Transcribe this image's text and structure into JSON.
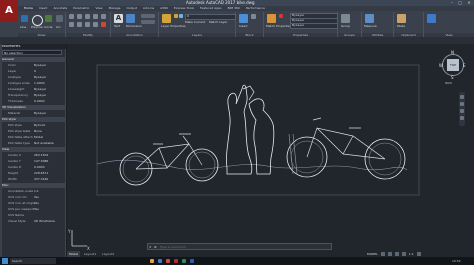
{
  "window": {
    "title": "Autodesk AutoCAD 2017   bike.dwg"
  },
  "app": {
    "logo": "A",
    "accent": "#8f1b1b"
  },
  "ribbon_tabs": [
    "Home",
    "Insert",
    "Annotate",
    "Parametric",
    "View",
    "Manage",
    "Output",
    "Add-ins",
    "A360",
    "Express Tools",
    "Featured Apps",
    "BIM 360",
    "Performance"
  ],
  "ribbon": {
    "panels": [
      "Draw",
      "Modify",
      "Annotation",
      "Layers",
      "Block",
      "Properties",
      "Groups",
      "Utilities",
      "Clipboard",
      "View"
    ],
    "draw_tools": [
      "Line",
      "Polyline",
      "Circle",
      "Arc"
    ],
    "text_tool": "Text",
    "dimension_tool": "Dimension",
    "insert_tool": "Insert",
    "match_properties_tool": "Match Properties",
    "layer_properties_tool": "Layer Properties",
    "layer_combo": "0",
    "bylayer_1": "ByLayer",
    "bylayer_2": "ByLayer",
    "bylayer_3": "ByLayer",
    "make_current": "Make Current",
    "match_layer": "Match Layer",
    "measure_tool": "Measure",
    "paste_tool": "Paste",
    "group_tool": "Group"
  },
  "properties": {
    "header": "PROPERTIES",
    "object_type": "No selection",
    "sections": [
      {
        "name": "General",
        "rows": [
          {
            "k": "Color",
            "v": "ByLayer"
          },
          {
            "k": "Layer",
            "v": "0"
          },
          {
            "k": "Linetype",
            "v": "ByLayer"
          },
          {
            "k": "Linetype scale",
            "v": "1.0000"
          },
          {
            "k": "Lineweight",
            "v": "ByLayer"
          },
          {
            "k": "Transparency",
            "v": "ByLayer"
          },
          {
            "k": "Thickness",
            "v": "0.0000"
          }
        ]
      },
      {
        "name": "3D Visualization",
        "rows": [
          {
            "k": "Material",
            "v": "ByLayer"
          }
        ]
      },
      {
        "name": "Plot style",
        "rows": [
          {
            "k": "Plot style",
            "v": "ByColor"
          },
          {
            "k": "Plot style table",
            "v": "None"
          },
          {
            "k": "Plot table attach",
            "v": "Model"
          },
          {
            "k": "Plot table type",
            "v": "Not available"
          }
        ]
      },
      {
        "name": "View",
        "rows": [
          {
            "k": "Center X",
            "v": "263.1504"
          },
          {
            "k": "Center Y",
            "v": "147.3086"
          },
          {
            "k": "Center Z",
            "v": "0.0000"
          },
          {
            "k": "Height",
            "v": "228.6571"
          },
          {
            "k": "Width",
            "v": "437.3160"
          }
        ]
      },
      {
        "name": "Misc",
        "rows": [
          {
            "k": "Annotation scale",
            "v": "1:1"
          },
          {
            "k": "UCS icon On",
            "v": "Yes"
          },
          {
            "k": "UCS icon at origin",
            "v": "Yes"
          },
          {
            "k": "UCS per viewport",
            "v": "Yes"
          },
          {
            "k": "UCS Name",
            "v": ""
          },
          {
            "k": "Visual Style",
            "v": "2D Wireframe"
          }
        ]
      }
    ]
  },
  "viewcube": {
    "n": "N",
    "s": "S",
    "e": "E",
    "w": "W",
    "face": "TOP",
    "ucs": "WCS"
  },
  "command_line": {
    "placeholder": "Type a command"
  },
  "layout_tabs": [
    "Model",
    "Layout1",
    "Layout2"
  ],
  "status": {
    "model": "MODEL",
    "scale": "1:1"
  },
  "taskbar": {
    "search": "Search",
    "time": "10:52"
  }
}
